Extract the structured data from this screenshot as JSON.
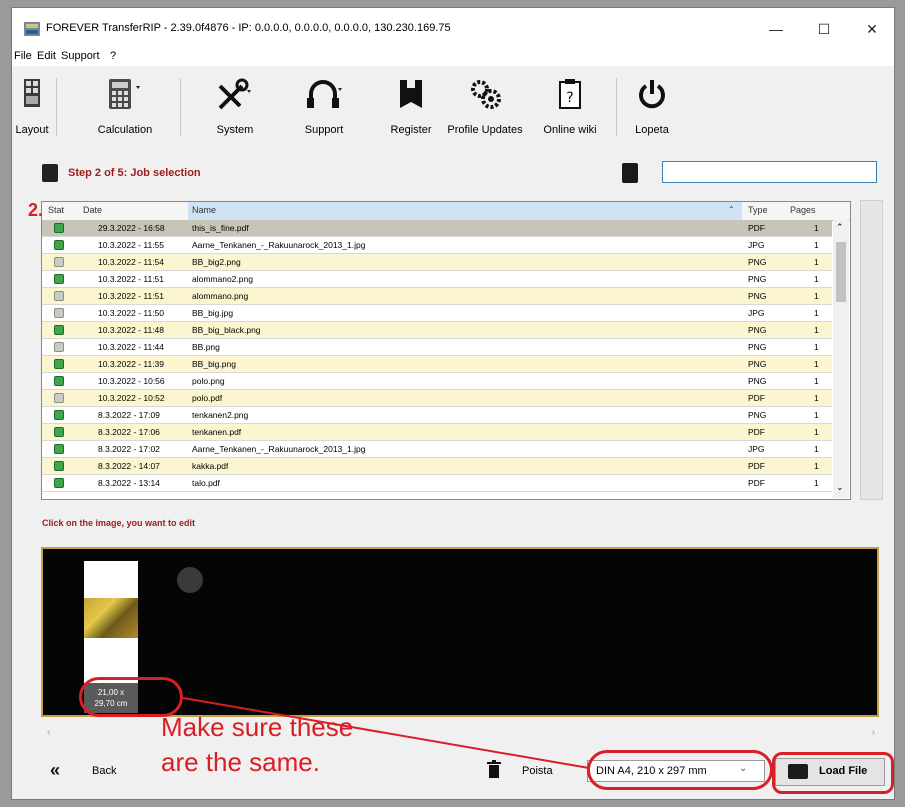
{
  "window": {
    "title": "FOREVER TransferRIP - 2.39.0f4876 - IP: 0.0.0.0, 0.0.0.0, 0.0.0.0, 130.230.169.75",
    "minimize": "—",
    "maximize": "☐",
    "close": "✕"
  },
  "menu": [
    "File",
    "Edit",
    "Support",
    "?"
  ],
  "toolbar": [
    {
      "label": "Layout",
      "icon": "layout-icon"
    },
    {
      "label": "Calculation",
      "icon": "calculator-icon"
    },
    {
      "label": "System",
      "icon": "tools-icon"
    },
    {
      "label": "Support",
      "icon": "support-icon"
    },
    {
      "label": "Register",
      "icon": "register-icon"
    },
    {
      "label": "Profile Updates",
      "icon": "gears-icon"
    },
    {
      "label": "Online wiki",
      "icon": "help-doc-icon"
    },
    {
      "label": "Lopeta",
      "icon": "power-icon"
    }
  ],
  "step": {
    "title": "Step 2 of 5: Job selection"
  },
  "search": {
    "value": "",
    "placeholder": ""
  },
  "table": {
    "headers": {
      "stat": "Stat",
      "date": "Date",
      "name": "Name",
      "type": "Type",
      "pages": "Pages"
    },
    "rows": [
      {
        "status": "ok",
        "date": "29.3.2022 - 16:58",
        "name": "this_is_fine.pdf",
        "type": "PDF",
        "pages": "1",
        "style": "sel"
      },
      {
        "status": "ok",
        "date": "10.3.2022 - 11:55",
        "name": "Aarne_Tenkanen_-_Rakuunarock_2013_1.jpg",
        "type": "JPG",
        "pages": "1",
        "style": "w"
      },
      {
        "status": "gray",
        "date": "10.3.2022 - 11:54",
        "name": "BB_big2.png",
        "type": "PNG",
        "pages": "1",
        "style": "y"
      },
      {
        "status": "ok",
        "date": "10.3.2022 - 11:51",
        "name": "alommano2.png",
        "type": "PNG",
        "pages": "1",
        "style": "w"
      },
      {
        "status": "gray",
        "date": "10.3.2022 - 11:51",
        "name": "alommano.png",
        "type": "PNG",
        "pages": "1",
        "style": "y"
      },
      {
        "status": "gray",
        "date": "10.3.2022 - 11:50",
        "name": "BB_big.jpg",
        "type": "JPG",
        "pages": "1",
        "style": "w"
      },
      {
        "status": "ok",
        "date": "10.3.2022 - 11:48",
        "name": "BB_big_black.png",
        "type": "PNG",
        "pages": "1",
        "style": "y"
      },
      {
        "status": "gray",
        "date": "10.3.2022 - 11:44",
        "name": "BB.png",
        "type": "PNG",
        "pages": "1",
        "style": "w"
      },
      {
        "status": "ok",
        "date": "10.3.2022 - 11:39",
        "name": "BB_big.png",
        "type": "PNG",
        "pages": "1",
        "style": "y"
      },
      {
        "status": "ok",
        "date": "10.3.2022 - 10:56",
        "name": "polo.png",
        "type": "PNG",
        "pages": "1",
        "style": "w"
      },
      {
        "status": "gray",
        "date": "10.3.2022 - 10:52",
        "name": "polo.pdf",
        "type": "PDF",
        "pages": "1",
        "style": "y"
      },
      {
        "status": "ok",
        "date": "8.3.2022 - 17:09",
        "name": "tenkanen2.png",
        "type": "PNG",
        "pages": "1",
        "style": "w"
      },
      {
        "status": "ok",
        "date": "8.3.2022 - 17:06",
        "name": "tenkanen.pdf",
        "type": "PDF",
        "pages": "1",
        "style": "y"
      },
      {
        "status": "ok",
        "date": "8.3.2022 - 17:02",
        "name": "Aarne_Tenkanen_-_Rakuunarock_2013_1.jpg",
        "type": "JPG",
        "pages": "1",
        "style": "w"
      },
      {
        "status": "ok",
        "date": "8.3.2022 - 14:07",
        "name": "kakka.pdf",
        "type": "PDF",
        "pages": "1",
        "style": "y"
      },
      {
        "status": "ok",
        "date": "8.3.2022 - 13:14",
        "name": "talo.pdf",
        "type": "PDF",
        "pages": "1",
        "style": "w"
      }
    ]
  },
  "hint": "Click on the image, you want to edit",
  "preview": {
    "size_line1": "21,00 x",
    "size_line2": "29,70 cm"
  },
  "bottom": {
    "back_label": "Back",
    "delete_label": "Poista",
    "format_value": "DIN A4, 210 x 297 mm",
    "load_label": "Load File"
  },
  "annotations": {
    "step_number": "2.",
    "note_line1": "Make sure these",
    "note_line2": "are the same.",
    "color": "#d81f26"
  }
}
